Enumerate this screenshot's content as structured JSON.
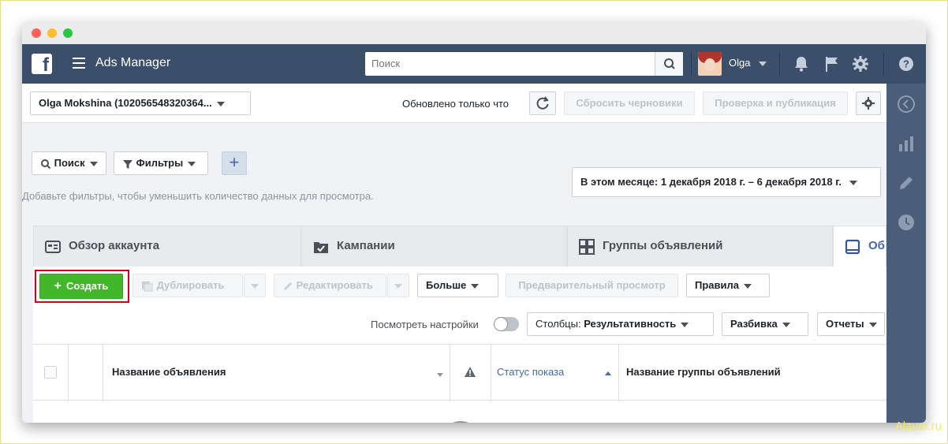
{
  "app": {
    "logo": "f",
    "title": "Ads Manager"
  },
  "topbar": {
    "search_placeholder": "Поиск",
    "user_name": "Olga",
    "icons": [
      "search-icon",
      "bell-icon",
      "flag-icon",
      "gear-icon",
      "help-icon"
    ]
  },
  "account_bar": {
    "account_selector": "Olga Mokshina (102056548320364...",
    "updated_text": "Обновлено только что",
    "discard_drafts": "Сбросить черновики",
    "review_publish": "Проверка и публикация"
  },
  "filter_bar": {
    "search_button": "Поиск",
    "filters_button": "Фильтры",
    "plus_label": "+",
    "hint": "Добавьте фильтры, чтобы уменьшить количество данных для просмотра.",
    "date_range": "В этом месяце: 1 декабря 2018 г. – 6 декабря 2018 г."
  },
  "tabs": [
    {
      "label": "Обзор аккаунта",
      "icon": "account-overview-icon"
    },
    {
      "label": "Кампании",
      "icon": "folder-check-icon"
    },
    {
      "label": "Группы объявлений",
      "icon": "grid-icon"
    },
    {
      "label": "Об",
      "icon": "ad-icon"
    }
  ],
  "toolbar": {
    "create_icon": "+",
    "create": "Создать",
    "duplicate": "Дублировать",
    "edit": "Редактировать",
    "more": "Больше",
    "preview": "Предварительный просмотр",
    "rules": "Правила",
    "view_settings": "Посмотреть настройки",
    "columns_prefix": "Столбцы:",
    "columns_value": "Результативность",
    "breakdown": "Разбивка",
    "reports": "Отчеты"
  },
  "table": {
    "columns": [
      "Название объявления",
      "Статус показа",
      "Название группы объявлений"
    ]
  },
  "bottom": {
    "add_icon": "+"
  },
  "watermark": "Alaver.ru",
  "colors": {
    "topbar": "#3b4e6a",
    "create": "#42b72a",
    "highlight": "#d0021b",
    "link": "#4267b2"
  }
}
